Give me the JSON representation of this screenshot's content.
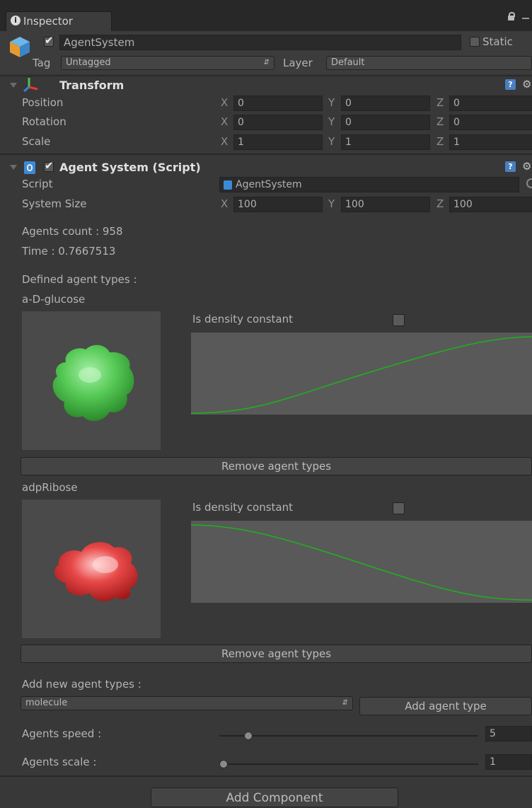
{
  "tab": {
    "label": "Inspector"
  },
  "gameobject": {
    "name": "AgentSystem",
    "static_label": "Static",
    "tag_label": "Tag",
    "tag_value": "Untagged",
    "layer_label": "Layer",
    "layer_value": "Default"
  },
  "transform": {
    "title": "Transform",
    "rows": [
      {
        "label": "Position",
        "x": "0",
        "y": "0",
        "z": "0"
      },
      {
        "label": "Rotation",
        "x": "0",
        "y": "0",
        "z": "0"
      },
      {
        "label": "Scale",
        "x": "1",
        "y": "1",
        "z": "1"
      }
    ]
  },
  "axes": {
    "x": "X",
    "y": "Y",
    "z": "Z"
  },
  "agent_system": {
    "title": "Agent System (Script)",
    "script_label": "Script",
    "script_value": "AgentSystem",
    "size_label": "System Size",
    "size": {
      "x": "100",
      "y": "100",
      "z": "100"
    },
    "agents_count": "Agents count : 958",
    "time": "Time : 0.7667513",
    "defined_types": "Defined agent types :",
    "agent_types": [
      {
        "name": "a-D-glucose",
        "density_label": "Is density constant",
        "remove_label": "Remove agent types",
        "color": "#4fc34f"
      },
      {
        "name": "adpRibose",
        "density_label": "Is density constant",
        "remove_label": "Remove agent types",
        "color": "#e23a3a"
      }
    ],
    "add_new_label": "Add new agent types :",
    "type_dropdown": "molecule",
    "add_button": "Add agent type",
    "speed_label": "Agents speed :",
    "speed_value": "5",
    "speed_fraction": 0.1,
    "scale_label": "Agents scale :",
    "scale_value": "1",
    "scale_fraction": 0.0
  },
  "add_component": "Add Component",
  "colors": {
    "curve": "#1db31d"
  }
}
